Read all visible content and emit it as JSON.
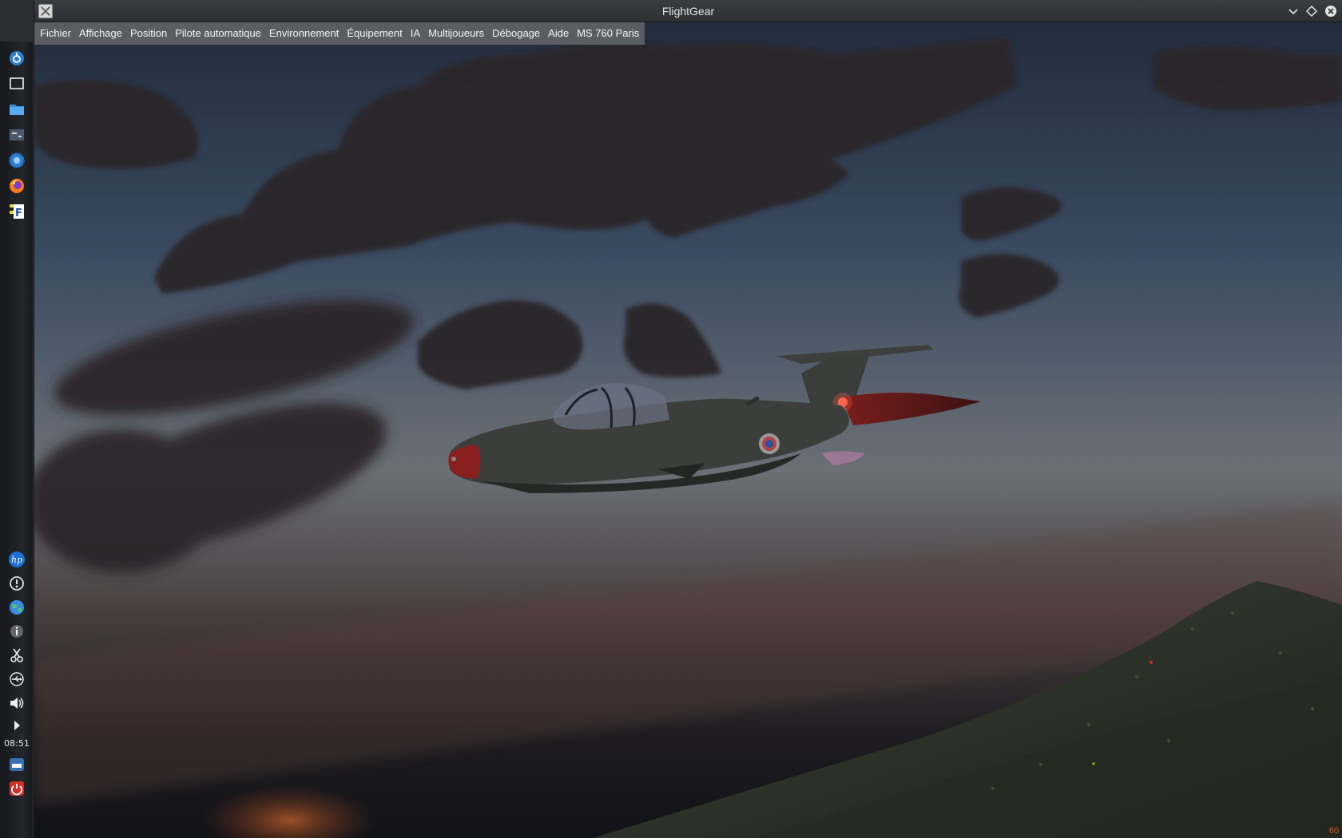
{
  "window": {
    "title": "FlightGear"
  },
  "menubar": {
    "items": [
      {
        "label": "Fichier"
      },
      {
        "label": "Affichage"
      },
      {
        "label": "Position"
      },
      {
        "label": "Pilote automatique"
      },
      {
        "label": "Environnement"
      },
      {
        "label": "Équipement"
      },
      {
        "label": "IA"
      },
      {
        "label": "Multijoueurs"
      },
      {
        "label": "Débogage"
      },
      {
        "label": "Aide"
      },
      {
        "label": "MS 760 Paris"
      }
    ]
  },
  "panel": {
    "clock": "08:51",
    "launchers": [
      "app-menu-icon",
      "desktop-icon",
      "file-manager-icon",
      "settings-panel-icon",
      "system-settings-icon",
      "firefox-icon",
      "flightgear-icon"
    ],
    "tray": [
      "hp-icon",
      "update-icon",
      "network-globe-icon",
      "info-icon",
      "scissors-icon",
      "usb-icon",
      "volume-icon",
      "expand-arrow-icon",
      "storage-icon",
      "power-icon"
    ]
  },
  "status": {
    "fps": "60"
  },
  "colors": {
    "sky_top": "#2a3344",
    "sky_horizon": "#6a6c70",
    "menu_bg": "#5f6267",
    "fps_text": "#d9531e"
  }
}
